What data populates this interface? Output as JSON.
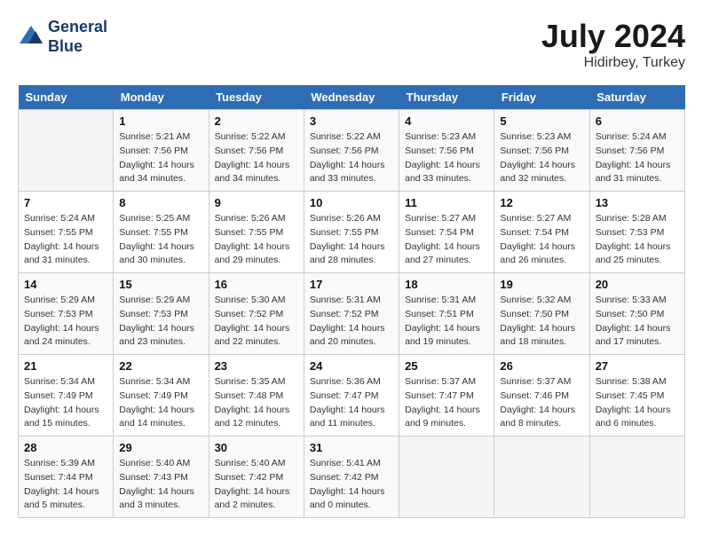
{
  "header": {
    "logo_line1": "General",
    "logo_line2": "Blue",
    "month_year": "July 2024",
    "location": "Hidirbey, Turkey"
  },
  "weekdays": [
    "Sunday",
    "Monday",
    "Tuesday",
    "Wednesday",
    "Thursday",
    "Friday",
    "Saturday"
  ],
  "weeks": [
    [
      {
        "day": "",
        "sunrise": "",
        "sunset": "",
        "daylight": "",
        "empty": true
      },
      {
        "day": "1",
        "sunrise": "5:21 AM",
        "sunset": "7:56 PM",
        "daylight": "14 hours and 34 minutes."
      },
      {
        "day": "2",
        "sunrise": "5:22 AM",
        "sunset": "7:56 PM",
        "daylight": "14 hours and 34 minutes."
      },
      {
        "day": "3",
        "sunrise": "5:22 AM",
        "sunset": "7:56 PM",
        "daylight": "14 hours and 33 minutes."
      },
      {
        "day": "4",
        "sunrise": "5:23 AM",
        "sunset": "7:56 PM",
        "daylight": "14 hours and 33 minutes."
      },
      {
        "day": "5",
        "sunrise": "5:23 AM",
        "sunset": "7:56 PM",
        "daylight": "14 hours and 32 minutes."
      },
      {
        "day": "6",
        "sunrise": "5:24 AM",
        "sunset": "7:56 PM",
        "daylight": "14 hours and 31 minutes."
      }
    ],
    [
      {
        "day": "7",
        "sunrise": "5:24 AM",
        "sunset": "7:55 PM",
        "daylight": "14 hours and 31 minutes."
      },
      {
        "day": "8",
        "sunrise": "5:25 AM",
        "sunset": "7:55 PM",
        "daylight": "14 hours and 30 minutes."
      },
      {
        "day": "9",
        "sunrise": "5:26 AM",
        "sunset": "7:55 PM",
        "daylight": "14 hours and 29 minutes."
      },
      {
        "day": "10",
        "sunrise": "5:26 AM",
        "sunset": "7:55 PM",
        "daylight": "14 hours and 28 minutes."
      },
      {
        "day": "11",
        "sunrise": "5:27 AM",
        "sunset": "7:54 PM",
        "daylight": "14 hours and 27 minutes."
      },
      {
        "day": "12",
        "sunrise": "5:27 AM",
        "sunset": "7:54 PM",
        "daylight": "14 hours and 26 minutes."
      },
      {
        "day": "13",
        "sunrise": "5:28 AM",
        "sunset": "7:53 PM",
        "daylight": "14 hours and 25 minutes."
      }
    ],
    [
      {
        "day": "14",
        "sunrise": "5:29 AM",
        "sunset": "7:53 PM",
        "daylight": "14 hours and 24 minutes."
      },
      {
        "day": "15",
        "sunrise": "5:29 AM",
        "sunset": "7:53 PM",
        "daylight": "14 hours and 23 minutes."
      },
      {
        "day": "16",
        "sunrise": "5:30 AM",
        "sunset": "7:52 PM",
        "daylight": "14 hours and 22 minutes."
      },
      {
        "day": "17",
        "sunrise": "5:31 AM",
        "sunset": "7:52 PM",
        "daylight": "14 hours and 20 minutes."
      },
      {
        "day": "18",
        "sunrise": "5:31 AM",
        "sunset": "7:51 PM",
        "daylight": "14 hours and 19 minutes."
      },
      {
        "day": "19",
        "sunrise": "5:32 AM",
        "sunset": "7:50 PM",
        "daylight": "14 hours and 18 minutes."
      },
      {
        "day": "20",
        "sunrise": "5:33 AM",
        "sunset": "7:50 PM",
        "daylight": "14 hours and 17 minutes."
      }
    ],
    [
      {
        "day": "21",
        "sunrise": "5:34 AM",
        "sunset": "7:49 PM",
        "daylight": "14 hours and 15 minutes."
      },
      {
        "day": "22",
        "sunrise": "5:34 AM",
        "sunset": "7:49 PM",
        "daylight": "14 hours and 14 minutes."
      },
      {
        "day": "23",
        "sunrise": "5:35 AM",
        "sunset": "7:48 PM",
        "daylight": "14 hours and 12 minutes."
      },
      {
        "day": "24",
        "sunrise": "5:36 AM",
        "sunset": "7:47 PM",
        "daylight": "14 hours and 11 minutes."
      },
      {
        "day": "25",
        "sunrise": "5:37 AM",
        "sunset": "7:47 PM",
        "daylight": "14 hours and 9 minutes."
      },
      {
        "day": "26",
        "sunrise": "5:37 AM",
        "sunset": "7:46 PM",
        "daylight": "14 hours and 8 minutes."
      },
      {
        "day": "27",
        "sunrise": "5:38 AM",
        "sunset": "7:45 PM",
        "daylight": "14 hours and 6 minutes."
      }
    ],
    [
      {
        "day": "28",
        "sunrise": "5:39 AM",
        "sunset": "7:44 PM",
        "daylight": "14 hours and 5 minutes."
      },
      {
        "day": "29",
        "sunrise": "5:40 AM",
        "sunset": "7:43 PM",
        "daylight": "14 hours and 3 minutes."
      },
      {
        "day": "30",
        "sunrise": "5:40 AM",
        "sunset": "7:42 PM",
        "daylight": "14 hours and 2 minutes."
      },
      {
        "day": "31",
        "sunrise": "5:41 AM",
        "sunset": "7:42 PM",
        "daylight": "14 hours and 0 minutes."
      },
      {
        "day": "",
        "sunrise": "",
        "sunset": "",
        "daylight": "",
        "empty": true
      },
      {
        "day": "",
        "sunrise": "",
        "sunset": "",
        "daylight": "",
        "empty": true
      },
      {
        "day": "",
        "sunrise": "",
        "sunset": "",
        "daylight": "",
        "empty": true
      }
    ]
  ]
}
